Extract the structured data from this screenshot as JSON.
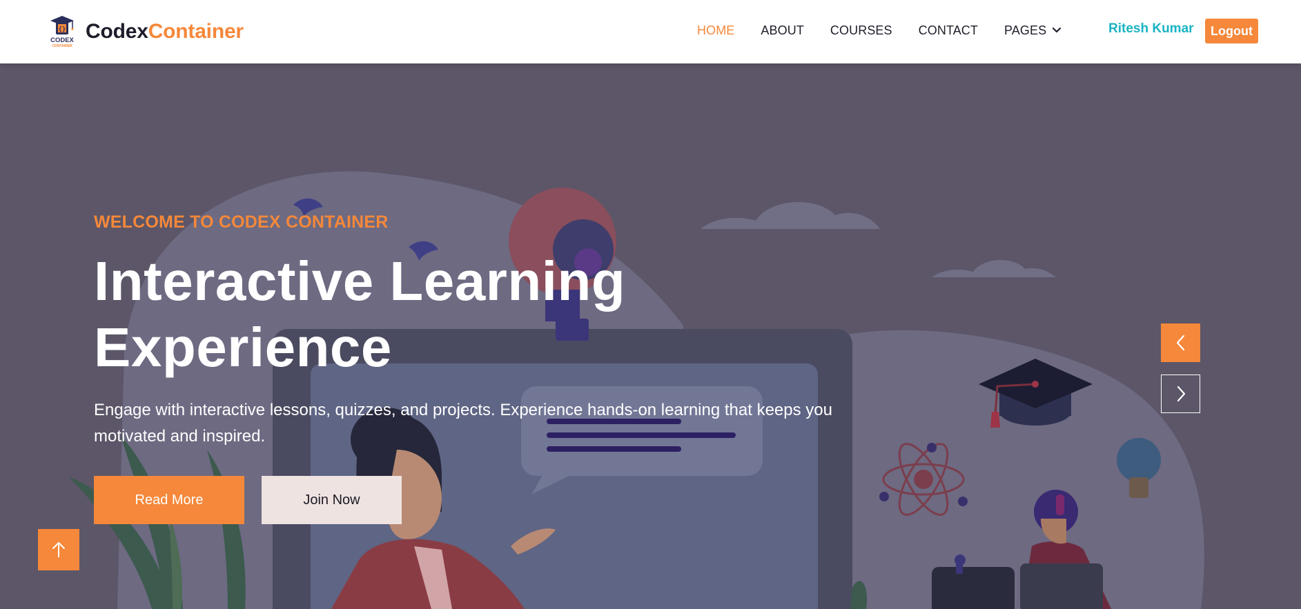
{
  "brand": {
    "logo_text": "CODEX",
    "logo_subtext": "CONTAINER",
    "name_part1": "Codex",
    "name_part2": "Container"
  },
  "nav": {
    "items": [
      {
        "label": "HOME",
        "active": true
      },
      {
        "label": "ABOUT",
        "active": false
      },
      {
        "label": "COURSES",
        "active": false
      },
      {
        "label": "CONTACT",
        "active": false
      },
      {
        "label": "PAGES",
        "active": false,
        "dropdown": true
      }
    ],
    "user_name": "Ritesh Kumar",
    "logout_label": "Logout"
  },
  "hero": {
    "kicker": "WELCOME TO CODEX CONTAINER",
    "headline_line1": "Interactive Learning",
    "headline_line2": "Experience",
    "subtext": "Engage with interactive lessons, quizzes, and projects. Experience hands-on learning that keeps you motivated and inspired.",
    "read_more_label": "Read More",
    "join_now_label": "Join Now"
  },
  "icons": {
    "carousel_prev": "chevron-left-icon",
    "carousel_next": "chevron-right-icon",
    "back_to_top": "arrow-up-icon",
    "pages_dropdown": "chevron-down-icon"
  },
  "colors": {
    "accent": "#f5883a",
    "user_name": "#1ab3c4",
    "hero_overlay": "#5c5668",
    "text_dark": "#1e1e2a"
  }
}
